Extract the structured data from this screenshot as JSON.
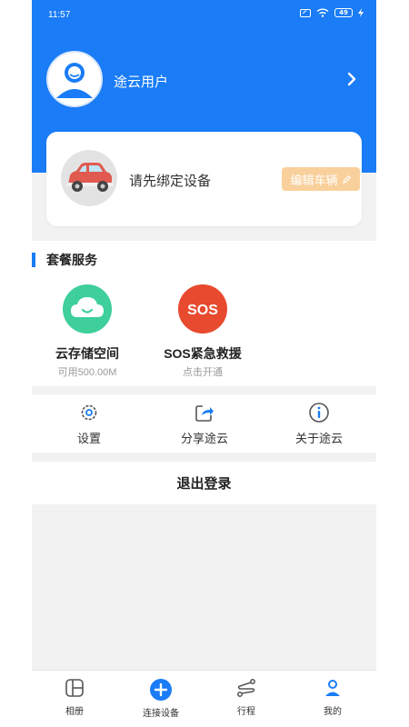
{
  "status_bar": {
    "time": "11:57",
    "battery": "49"
  },
  "user": {
    "name": "途云用户"
  },
  "device_card": {
    "bind_text": "请先绑定设备",
    "edit_label": "编辑车辆"
  },
  "package": {
    "title": "套餐服务",
    "services": [
      {
        "name": "云存储空间",
        "sub": "可用500.00M",
        "icon": "cloud-icon"
      },
      {
        "name": "SOS紧急救援",
        "sub": "点击开通",
        "icon": "sos-icon",
        "icon_text": "SOS"
      }
    ]
  },
  "tools": [
    {
      "label": "设置",
      "icon": "gear-icon"
    },
    {
      "label": "分享途云",
      "icon": "share-icon"
    },
    {
      "label": "关于途云",
      "icon": "info-icon"
    }
  ],
  "logout_label": "退出登录",
  "tabs": [
    {
      "label": "相册",
      "icon": "album-icon"
    },
    {
      "label": "连接设备",
      "icon": "plus-circle-icon"
    },
    {
      "label": "行程",
      "icon": "route-icon"
    },
    {
      "label": "我的",
      "icon": "profile-icon",
      "active": true
    }
  ],
  "colors": {
    "primary": "#1a7cf6",
    "edit_button": "#f9d09c",
    "cloud": "#3ecf9b",
    "sos": "#e84a2f"
  }
}
